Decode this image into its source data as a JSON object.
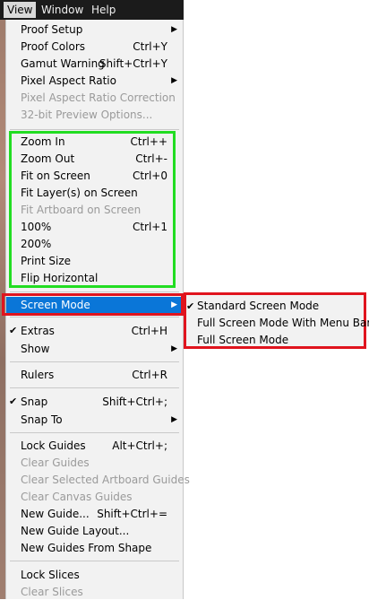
{
  "menubar": {
    "items": [
      "View",
      "Window",
      "Help"
    ],
    "active": "View"
  },
  "menu": {
    "group1": [
      {
        "label": "Proof Setup",
        "shortcut": "",
        "submenu": true,
        "disabled": false
      },
      {
        "label": "Proof Colors",
        "shortcut": "Ctrl+Y",
        "submenu": false,
        "disabled": false
      },
      {
        "label": "Gamut Warning",
        "shortcut": "Shift+Ctrl+Y",
        "submenu": false,
        "disabled": false
      },
      {
        "label": "Pixel Aspect Ratio",
        "shortcut": "",
        "submenu": true,
        "disabled": false
      },
      {
        "label": "Pixel Aspect Ratio Correction",
        "shortcut": "",
        "submenu": false,
        "disabled": true
      },
      {
        "label": "32-bit Preview Options...",
        "shortcut": "",
        "submenu": false,
        "disabled": true
      }
    ],
    "group2": [
      {
        "label": "Zoom In",
        "shortcut": "Ctrl++",
        "disabled": false
      },
      {
        "label": "Zoom Out",
        "shortcut": "Ctrl+-",
        "disabled": false
      },
      {
        "label": "Fit on Screen",
        "shortcut": "Ctrl+0",
        "disabled": false
      },
      {
        "label": "Fit Layer(s) on Screen",
        "shortcut": "",
        "disabled": false
      },
      {
        "label": "Fit Artboard on Screen",
        "shortcut": "",
        "disabled": true
      },
      {
        "label": "100%",
        "shortcut": "Ctrl+1",
        "disabled": false
      },
      {
        "label": "200%",
        "shortcut": "",
        "disabled": false
      },
      {
        "label": "Print Size",
        "shortcut": "",
        "disabled": false
      },
      {
        "label": "Flip Horizontal",
        "shortcut": "",
        "disabled": false
      }
    ],
    "screen_mode": {
      "label": "Screen Mode",
      "submenu": true
    },
    "group3": [
      {
        "label": "Extras",
        "shortcut": "Ctrl+H",
        "checked": true,
        "submenu": false
      },
      {
        "label": "Show",
        "shortcut": "",
        "checked": false,
        "submenu": true
      }
    ],
    "group4": [
      {
        "label": "Rulers",
        "shortcut": "Ctrl+R",
        "checked": false,
        "submenu": false
      }
    ],
    "group5": [
      {
        "label": "Snap",
        "shortcut": "Shift+Ctrl+;",
        "checked": true,
        "submenu": false
      },
      {
        "label": "Snap To",
        "shortcut": "",
        "checked": false,
        "submenu": true
      }
    ],
    "group6": [
      {
        "label": "Lock Guides",
        "shortcut": "Alt+Ctrl+;",
        "disabled": false
      },
      {
        "label": "Clear Guides",
        "shortcut": "",
        "disabled": true
      },
      {
        "label": "Clear Selected Artboard Guides",
        "shortcut": "",
        "disabled": true
      },
      {
        "label": "Clear Canvas Guides",
        "shortcut": "",
        "disabled": true
      },
      {
        "label": "New Guide...",
        "shortcut": "Shift+Ctrl+=",
        "disabled": false
      },
      {
        "label": "New Guide Layout...",
        "shortcut": "",
        "disabled": false
      },
      {
        "label": "New Guides From Shape",
        "shortcut": "",
        "disabled": false
      }
    ],
    "group7": [
      {
        "label": "Lock Slices",
        "shortcut": "",
        "disabled": false
      },
      {
        "label": "Clear Slices",
        "shortcut": "",
        "disabled": true
      }
    ]
  },
  "submenu": {
    "items": [
      {
        "label": "Standard Screen Mode",
        "checked": true
      },
      {
        "label": "Full Screen Mode With Menu Bar",
        "checked": false
      },
      {
        "label": "Full Screen Mode",
        "checked": false
      }
    ]
  },
  "glyphs": {
    "check": "✔",
    "arrow": "▶"
  },
  "colors": {
    "highlight": "#0a76d8",
    "green_box": "#22dd22",
    "red_box": "#e0141e",
    "menu_bg": "#f2f2f2",
    "menubar_bg": "#1b1b1b"
  }
}
